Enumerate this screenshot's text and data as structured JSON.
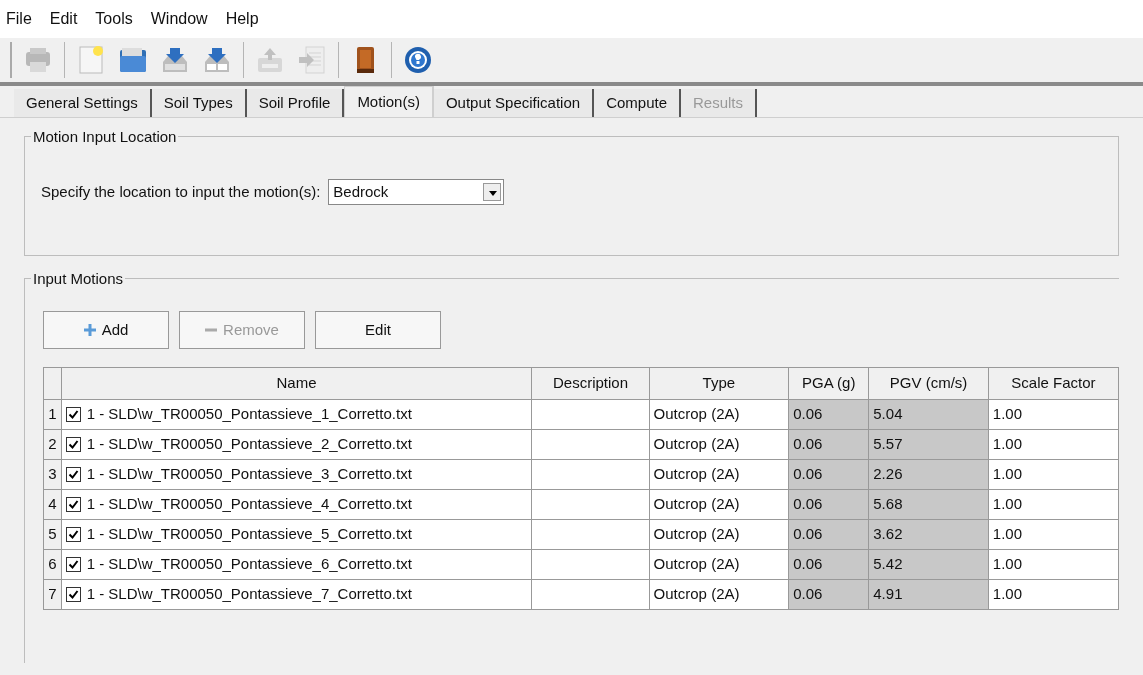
{
  "menu": [
    "File",
    "Edit",
    "Tools",
    "Window",
    "Help"
  ],
  "toolbar": [
    {
      "kind": "printer",
      "disabled": true
    },
    {
      "kind": "sep"
    },
    {
      "kind": "new"
    },
    {
      "kind": "open"
    },
    {
      "kind": "save"
    },
    {
      "kind": "saveas"
    },
    {
      "kind": "sep"
    },
    {
      "kind": "import",
      "disabled": true
    },
    {
      "kind": "export",
      "disabled": true
    },
    {
      "kind": "sep"
    },
    {
      "kind": "book"
    },
    {
      "kind": "sep"
    },
    {
      "kind": "help"
    }
  ],
  "tabs": [
    {
      "label": "General Settings",
      "selected": false,
      "disabled": false
    },
    {
      "label": "Soil Types",
      "selected": false,
      "disabled": false
    },
    {
      "label": "Soil Profile",
      "selected": false,
      "disabled": false
    },
    {
      "label": "Motion(s)",
      "selected": true,
      "disabled": false
    },
    {
      "label": "Output Specification",
      "selected": false,
      "disabled": false
    },
    {
      "label": "Compute",
      "selected": false,
      "disabled": false
    },
    {
      "label": "Results",
      "selected": false,
      "disabled": true
    }
  ],
  "location_group": {
    "title": "Motion Input Location",
    "label": "Specify the location to input the motion(s):",
    "value": "Bedrock"
  },
  "motions_group": {
    "title": "Input Motions",
    "buttons": [
      {
        "label": "Add",
        "kind": "plus",
        "disabled": false
      },
      {
        "label": "Remove",
        "kind": "minus",
        "disabled": true
      },
      {
        "label": "Edit",
        "kind": "plain",
        "disabled": false
      }
    ],
    "table": {
      "columns": [
        "Name",
        "Description",
        "Type",
        "PGA (g)",
        "PGV (cm/s)",
        "Scale Factor"
      ],
      "rows": [
        {
          "index": "1",
          "checked": true,
          "name": "1 - SLD\\w_TR00050_Pontassieve_1_Corretto.txt",
          "type": "Outcrop (2A)",
          "pga": "0.06",
          "pgv": "5.04",
          "scale": "1.00"
        },
        {
          "index": "2",
          "checked": true,
          "name": "1 - SLD\\w_TR00050_Pontassieve_2_Corretto.txt",
          "type": "Outcrop (2A)",
          "pga": "0.06",
          "pgv": "5.57",
          "scale": "1.00"
        },
        {
          "index": "3",
          "checked": true,
          "name": "1 - SLD\\w_TR00050_Pontassieve_3_Corretto.txt",
          "type": "Outcrop (2A)",
          "pga": "0.06",
          "pgv": "2.26",
          "scale": "1.00"
        },
        {
          "index": "4",
          "checked": true,
          "name": "1 - SLD\\w_TR00050_Pontassieve_4_Corretto.txt",
          "type": "Outcrop (2A)",
          "pga": "0.06",
          "pgv": "5.68",
          "scale": "1.00"
        },
        {
          "index": "5",
          "checked": true,
          "name": "1 - SLD\\w_TR00050_Pontassieve_5_Corretto.txt",
          "type": "Outcrop (2A)",
          "pga": "0.06",
          "pgv": "3.62",
          "scale": "1.00"
        },
        {
          "index": "6",
          "checked": true,
          "name": "1 - SLD\\w_TR00050_Pontassieve_6_Corretto.txt",
          "type": "Outcrop (2A)",
          "pga": "0.06",
          "pgv": "5.42",
          "scale": "1.00"
        },
        {
          "index": "7",
          "checked": true,
          "name": "1 - SLD\\w_TR00050_Pontassieve_7_Corretto.txt",
          "type": "Outcrop (2A)",
          "pga": "0.06",
          "pgv": "4.91",
          "scale": "1.00"
        }
      ]
    }
  }
}
